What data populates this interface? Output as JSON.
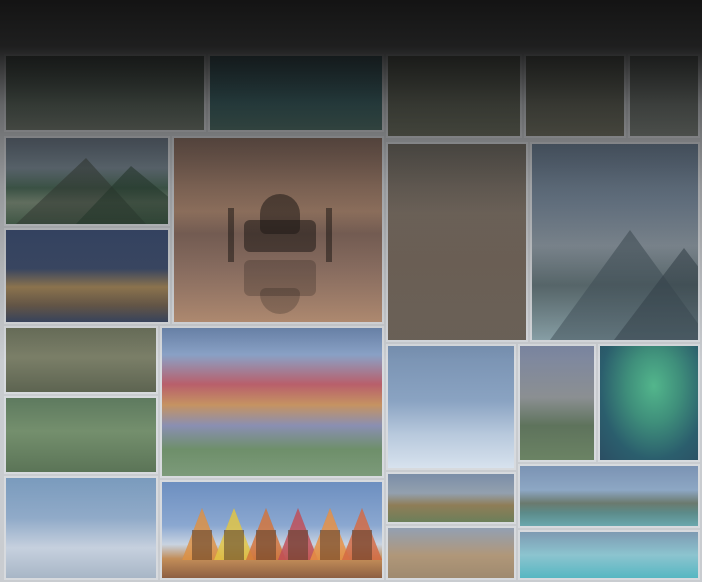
{
  "images": [
    {
      "name": "top-strip-photo-1"
    },
    {
      "name": "top-strip-photo-2"
    },
    {
      "name": "top-strip-photo-3"
    },
    {
      "name": "top-strip-photo-4"
    },
    {
      "name": "top-strip-photo-5"
    },
    {
      "name": "mountains-photo"
    },
    {
      "name": "taj-mahal-photo"
    },
    {
      "name": "venice-photo"
    },
    {
      "name": "petra-photo"
    },
    {
      "name": "glacier-photo"
    },
    {
      "name": "temple-ruins-photo"
    },
    {
      "name": "rice-terraces-photo"
    },
    {
      "name": "rainbow-mountains-photo"
    },
    {
      "name": "ice-cliffs-photo"
    },
    {
      "name": "sea-cliffs-photo"
    },
    {
      "name": "aurora-photo"
    },
    {
      "name": "castle-photo"
    },
    {
      "name": "huts-and-mountain-photo"
    },
    {
      "name": "savanna-photo"
    },
    {
      "name": "bora-bora-photo"
    },
    {
      "name": "camels-photo"
    },
    {
      "name": "bungalows-photo"
    }
  ]
}
